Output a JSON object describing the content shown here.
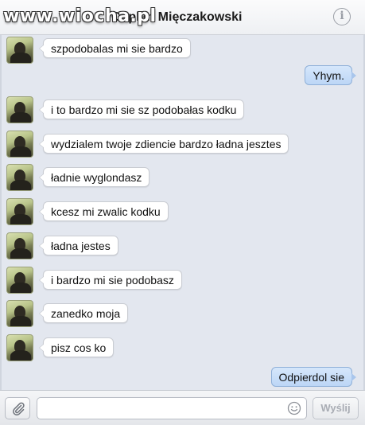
{
  "watermark": "www.wiocha.pl",
  "header": {
    "contact_name": "Coplan Mięczakowski",
    "info_icon": "info-icon"
  },
  "messages": [
    {
      "direction": "in",
      "text": "szpodobalas mi sie bardzo"
    },
    {
      "direction": "out",
      "text": "Yhym."
    },
    {
      "direction": "in",
      "text": "i to bardzo mi sie sz podobałas kodku"
    },
    {
      "direction": "in",
      "text": "wydzialem twoje zdiencie bardzo ładna jesztes"
    },
    {
      "direction": "in",
      "text": "ładnie wyglondasz"
    },
    {
      "direction": "in",
      "text": "kcesz mi zwalic kodku"
    },
    {
      "direction": "in",
      "text": "ładna jestes"
    },
    {
      "direction": "in",
      "text": "i bardzo mi sie podobasz"
    },
    {
      "direction": "in",
      "text": "zanedko moja"
    },
    {
      "direction": "in",
      "text": "pisz cos ko"
    },
    {
      "direction": "out",
      "text": "Odpierdol sie"
    }
  ],
  "composer": {
    "input_value": "",
    "input_placeholder": "",
    "send_label": "Wyślij",
    "attach_icon": "paperclip-icon",
    "emoji_icon": "smiley-icon"
  }
}
